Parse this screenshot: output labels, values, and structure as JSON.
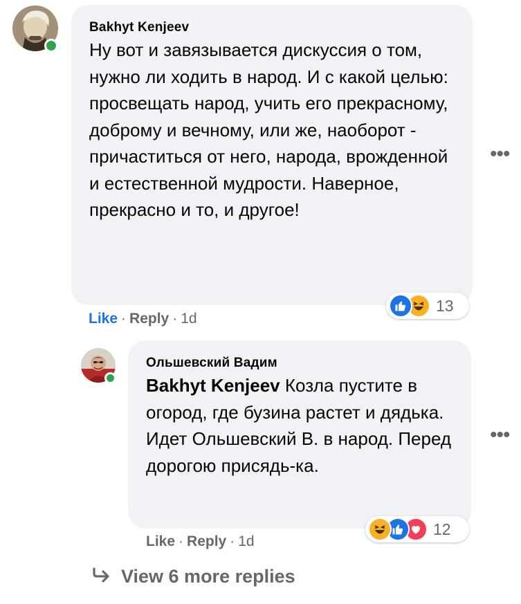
{
  "comment1": {
    "author": "Bakhyt Kenjeev",
    "text": "Ну вот и завязывается дискуссия о том, нужно ли ходить в народ. И с какой целью: просвещать народ, учить его прекрасному, доброму и вечному, или же, наоборот - причаститься от него, народа, врожденной и естественной мудрости. Наверное, прекрасно и то, и другое!",
    "like_label": "Like",
    "reply_label": "Reply",
    "time": "1d",
    "reaction_icons": [
      "like-icon",
      "haha-icon"
    ],
    "reaction_count": "13"
  },
  "reply1": {
    "author": "Ольшевский Вадим",
    "mention": "Bakhyt Kenjeev",
    "text": "Козла пустите в огород, где бузина растет и дядька. Идет Ольшевский В. в народ. Перед дорогою присядь-ка.",
    "like_label": "Like",
    "reply_label": "Reply",
    "time": "1d",
    "reaction_icons": [
      "haha-icon",
      "like-icon",
      "love-icon"
    ],
    "reaction_count": "12"
  },
  "view_more": {
    "label": "View 6 more replies",
    "icon": "reply-arrow-icon"
  },
  "colors": {
    "bubble": "#f0f2f5",
    "like_blue": "#1b74e4",
    "muted": "#65676b",
    "online": "#31a24c",
    "love": "#f33e58",
    "haha": "#f7b125"
  }
}
